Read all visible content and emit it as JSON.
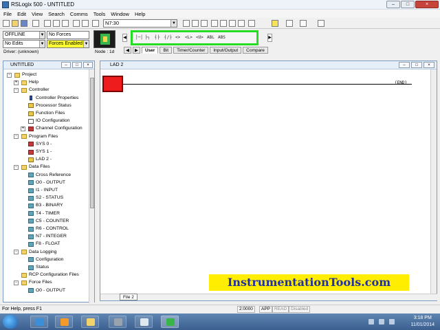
{
  "window": {
    "title": "RSLogix 500 - UNTITLED",
    "controls": [
      "–",
      "□",
      "×"
    ]
  },
  "menu": [
    "File",
    "Edit",
    "View",
    "Search",
    "Comms",
    "Tools",
    "Window",
    "Help"
  ],
  "toolbar": {
    "address_value": "N7:30"
  },
  "status": {
    "mode": "OFFLINE",
    "forces": "No Forces",
    "edits": "No Edits",
    "forces_enabled": "Forces Enabled",
    "driver": "Driver: (unknown)",
    "node": "Node : 1d"
  },
  "palette": {
    "symbols": [
      "│─│",
      "├┐",
      "┤├",
      "┤/├",
      "<>",
      "<L>",
      "<U>",
      "ABL",
      "ABS"
    ],
    "tabs": [
      "User",
      "Bit",
      "Timer/Counter",
      "Input/Output",
      "Compare"
    ],
    "active_tab": "User",
    "highlight_color": "#22dd22"
  },
  "project": {
    "title": "UNTITLED",
    "nodes": [
      {
        "label": "Project",
        "level": 0,
        "icon": "folder",
        "exp": "-"
      },
      {
        "label": "Help",
        "level": 1,
        "icon": "folder",
        "exp": "+"
      },
      {
        "label": "Controller",
        "level": 1,
        "icon": "folder",
        "exp": "-"
      },
      {
        "label": "Controller Properties",
        "level": 2,
        "icon": "info"
      },
      {
        "label": "Processor Status",
        "level": 2,
        "icon": "ctrl"
      },
      {
        "label": "Function Files",
        "level": 2,
        "icon": "ctrl"
      },
      {
        "label": "IO Configuration",
        "level": 2,
        "icon": "file"
      },
      {
        "label": "Channel Configuration",
        "level": 2,
        "icon": "prog",
        "exp": "+"
      },
      {
        "label": "Program Files",
        "level": 1,
        "icon": "folder",
        "exp": "-"
      },
      {
        "label": "SYS 0 -",
        "level": 2,
        "icon": "prog"
      },
      {
        "label": "SYS 1 -",
        "level": 2,
        "icon": "prog"
      },
      {
        "label": "LAD 2 -",
        "level": 2,
        "icon": "ctrl"
      },
      {
        "label": "Data Files",
        "level": 1,
        "icon": "folder",
        "exp": "-"
      },
      {
        "label": "Cross Reference",
        "level": 2,
        "icon": "data"
      },
      {
        "label": "O0 - OUTPUT",
        "level": 2,
        "icon": "data"
      },
      {
        "label": "I1 - INPUT",
        "level": 2,
        "icon": "data"
      },
      {
        "label": "S2 - STATUS",
        "level": 2,
        "icon": "data"
      },
      {
        "label": "B3 - BINARY",
        "level": 2,
        "icon": "data"
      },
      {
        "label": "T4 - TIMER",
        "level": 2,
        "icon": "data"
      },
      {
        "label": "C5 - COUNTER",
        "level": 2,
        "icon": "data"
      },
      {
        "label": "R6 - CONTROL",
        "level": 2,
        "icon": "data"
      },
      {
        "label": "N7 - INTEGER",
        "level": 2,
        "icon": "data"
      },
      {
        "label": "F8 - FLOAT",
        "level": 2,
        "icon": "data"
      },
      {
        "label": "Data Logging",
        "level": 1,
        "icon": "folder",
        "exp": "-"
      },
      {
        "label": "Configuration",
        "level": 2,
        "icon": "data"
      },
      {
        "label": "Status",
        "level": 2,
        "icon": "data"
      },
      {
        "label": "RCP Configuration Files",
        "level": 1,
        "icon": "folder"
      },
      {
        "label": "Force Files",
        "level": 1,
        "icon": "folder",
        "exp": "-"
      },
      {
        "label": "O0 - OUTPUT",
        "level": 2,
        "icon": "data"
      }
    ]
  },
  "ladder": {
    "title": "LAD 2",
    "end_label": "(END)",
    "file_tab": "File 2",
    "rung_color": "#ee1c1c"
  },
  "banner": {
    "text": "InstrumentationTools.com",
    "bg": "#ffee00",
    "color": "#1f2fa8"
  },
  "statusbar": {
    "help": "For Help, press F1",
    "coord": "2:0000",
    "app": "APP",
    "read": "READ",
    "disabled": "Disabled"
  },
  "taskbar": {
    "time": "3:18 PM",
    "date": "11/01/2014"
  }
}
